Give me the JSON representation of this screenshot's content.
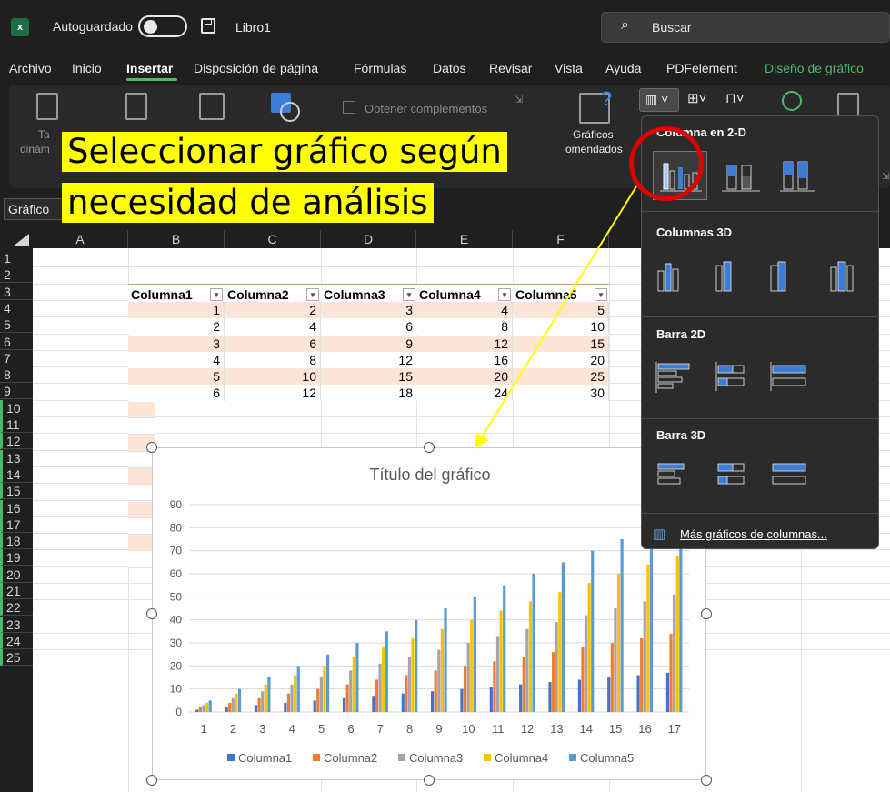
{
  "titlebar": {
    "app_icon": "excel-icon",
    "autosave_label": "Autoguardado",
    "file_name": "Libro1",
    "search_placeholder": "Buscar"
  },
  "menu": [
    "Archivo",
    "Inicio",
    "Insertar",
    "Disposición de página",
    "Fórmulas",
    "Datos",
    "Revisar",
    "Vista",
    "Ayuda",
    "PDFelement",
    "Diseño de gráfico"
  ],
  "ribbon": {
    "get_addins": "Obtener complementos",
    "recommended_line1": "Gráficos",
    "recommended_line2": "omendados",
    "pivot_partial_1": "Ta",
    "pivot_partial_2": "dinám"
  },
  "name_box": "Gráfico",
  "columns": [
    "A",
    "B",
    "C",
    "D",
    "E",
    "F"
  ],
  "rows": [
    "1",
    "2",
    "3",
    "4",
    "5",
    "6",
    "7",
    "8",
    "9",
    "10",
    "11",
    "12",
    "13",
    "14",
    "15",
    "16",
    "17",
    "18",
    "19",
    "20",
    "21",
    "22",
    "23",
    "24",
    "25"
  ],
  "table": {
    "headers": [
      "Columna1",
      "Columna2",
      "Columna3",
      "Columna4",
      "Columna5"
    ],
    "rows": [
      [
        "1",
        "2",
        "3",
        "4",
        "5"
      ],
      [
        "2",
        "4",
        "6",
        "8",
        "10"
      ],
      [
        "3",
        "6",
        "9",
        "12",
        "15"
      ],
      [
        "4",
        "8",
        "12",
        "16",
        "20"
      ],
      [
        "5",
        "10",
        "15",
        "20",
        "25"
      ],
      [
        "6",
        "12",
        "18",
        "24",
        "30"
      ]
    ]
  },
  "chart_data": {
    "type": "bar",
    "title": "Título del gráfico",
    "categories": [
      "1",
      "2",
      "3",
      "4",
      "5",
      "6",
      "7",
      "8",
      "9",
      "10",
      "11",
      "12",
      "13",
      "14",
      "15",
      "16",
      "17"
    ],
    "series": [
      {
        "name": "Columna1",
        "color": "#4472c4",
        "values": [
          1,
          2,
          3,
          4,
          5,
          6,
          7,
          8,
          9,
          10,
          11,
          12,
          13,
          14,
          15,
          16,
          17
        ]
      },
      {
        "name": "Columna2",
        "color": "#ed7d31",
        "values": [
          2,
          4,
          6,
          8,
          10,
          12,
          14,
          16,
          18,
          20,
          22,
          24,
          26,
          28,
          30,
          32,
          34
        ]
      },
      {
        "name": "Columna3",
        "color": "#a5a5a5",
        "values": [
          3,
          6,
          9,
          12,
          15,
          18,
          21,
          24,
          27,
          30,
          33,
          36,
          39,
          42,
          45,
          48,
          51
        ]
      },
      {
        "name": "Columna4",
        "color": "#ffc000",
        "values": [
          4,
          8,
          12,
          16,
          20,
          24,
          28,
          32,
          36,
          40,
          44,
          48,
          52,
          56,
          60,
          64,
          68
        ]
      },
      {
        "name": "Columna5",
        "color": "#5b9bd5",
        "values": [
          5,
          10,
          15,
          20,
          25,
          30,
          35,
          40,
          45,
          50,
          55,
          60,
          65,
          70,
          75,
          80,
          85
        ]
      }
    ],
    "yticks": [
      "0",
      "10",
      "20",
      "30",
      "40",
      "50",
      "60",
      "70",
      "80",
      "90"
    ],
    "ylim": [
      0,
      90
    ],
    "grid": true,
    "legend": "bottom"
  },
  "dropdown": {
    "sections": [
      "Columna en 2-D",
      "Columnas 3D",
      "Barra 2D",
      "Barra 3D"
    ],
    "more_link": "Más gráficos de columnas..."
  },
  "callout": {
    "line1": "Seleccionar gráfico según",
    "line2": "necesidad de análisis"
  },
  "colors": {
    "accent_green": "#4fb76a",
    "highlight_red": "#e00000",
    "callout_yellow": "#ffff00",
    "table_band": "#fce4d6"
  }
}
